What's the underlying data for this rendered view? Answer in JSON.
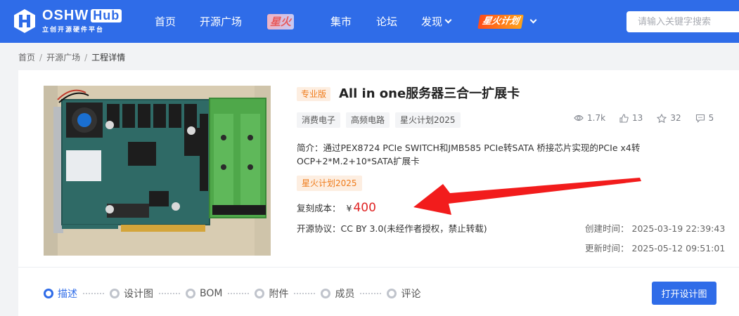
{
  "header": {
    "logo_brand": "OSHW",
    "logo_hub": "Hub",
    "logo_sub": "立创开源硬件平台",
    "nav": {
      "home": "首页",
      "plaza": "开源广场",
      "xinghuo_badge": "星火",
      "market": "集市",
      "forum": "论坛",
      "discover": "发现",
      "xinghuo_plan": "星火计划"
    },
    "search_placeholder": "请输入关键字搜索"
  },
  "breadcrumb": {
    "items": [
      "首页",
      "开源广场",
      "工程详情"
    ],
    "separator": "/"
  },
  "project": {
    "edition_tag": "专业版",
    "title": "All in one服务器三合一扩展卡",
    "tags": [
      "消费电子",
      "高频电路",
      "星火计划2025"
    ],
    "stats": {
      "views": "1.7k",
      "likes": "13",
      "stars": "32",
      "comments": "5"
    },
    "description": "简介：通过PEX8724 PCIe SWITCH和JMB585 PCIe转SATA 桥接芯片实现的PCIe x4转OCP+2*M.2+10*SATA扩展卡",
    "activity_tag": "星火计划2025",
    "cost_label": "复刻成本：",
    "currency": "¥",
    "cost_value": "400",
    "license_label": "开源协议：",
    "license_value": "CC BY 3.0(未经作者授权，禁止转载)",
    "created_label": "创建时间：",
    "created_value": "2025-03-19 22:39:43",
    "updated_label": "更新时间：",
    "updated_value": "2025-05-12 09:51:01"
  },
  "steps": [
    "描述",
    "设计图",
    "BOM",
    "附件",
    "成员",
    "评论"
  ],
  "open_button": "打开设计图",
  "colors": {
    "brand_blue": "#2f6ce8",
    "price_red": "#e02424",
    "tag_orange": "#ef7b1a",
    "arrow_red": "#f21c1c"
  }
}
